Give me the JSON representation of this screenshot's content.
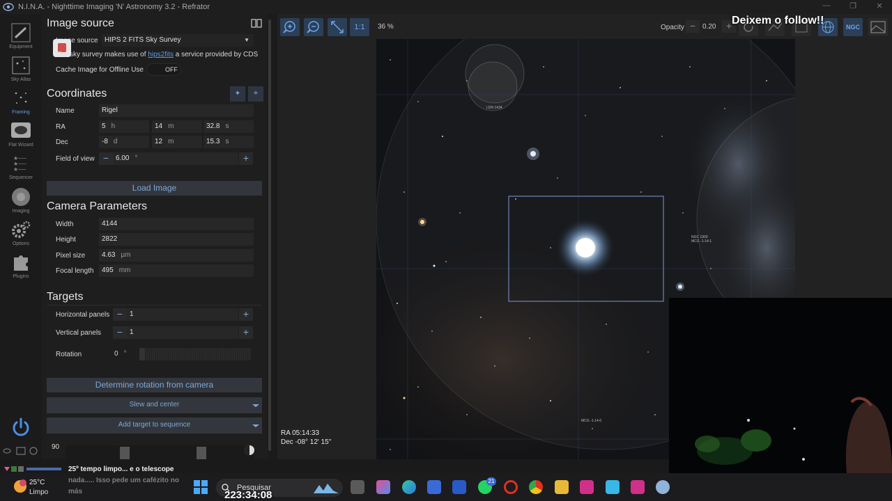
{
  "window": {
    "title": "N.I.N.A. - Nighttime Imaging 'N' Astronomy 3.2   -  Refrator"
  },
  "nav": {
    "items": [
      {
        "label": "Equipment"
      },
      {
        "label": "Sky Atlas"
      },
      {
        "label": "Framing",
        "active": true
      },
      {
        "label": "Flat Wizard"
      },
      {
        "label": "Sequencer"
      },
      {
        "label": "Imaging"
      },
      {
        "label": "Options"
      },
      {
        "label": "Plugins"
      }
    ]
  },
  "image_source": {
    "heading": "Image source",
    "source_label": "Image source",
    "source_value": "HIPS 2 FITS Sky Survey",
    "note_prefix": "The sky survey makes use of",
    "note_link": "hips2fits",
    "note_suffix": "a service provided by CDS",
    "cache_label": "Cache Image for Offline Use",
    "cache_toggle": "OFF"
  },
  "coordinates": {
    "heading": "Coordinates",
    "name_label": "Name",
    "name_value": "Rigel",
    "ra_label": "RA",
    "ra": {
      "h": "5",
      "h_unit": "h",
      "m": "14",
      "m_unit": "m",
      "s": "32.8",
      "s_unit": "s"
    },
    "dec_label": "Dec",
    "dec": {
      "d": "-8",
      "d_unit": "d",
      "m": "12",
      "m_unit": "m",
      "s": "15.3",
      "s_unit": "s"
    },
    "fov_label": "Field of view",
    "fov_value": "6.00",
    "fov_unit": "°",
    "load_button": "Load Image"
  },
  "camera": {
    "heading": "Camera Parameters",
    "width_label": "Width",
    "width_value": "4144",
    "height_label": "Height",
    "height_value": "2822",
    "pixel_label": "Pixel size",
    "pixel_value": "4.63",
    "pixel_unit": "µm",
    "focal_label": "Focal length",
    "focal_value": "495",
    "focal_unit": "mm"
  },
  "targets": {
    "heading": "Targets",
    "hpanels_label": "Horizontal panels",
    "hpanels_value": "1",
    "vpanels_label": "Vertical panels",
    "vpanels_value": "1",
    "rotation_label": "Rotation",
    "rotation_value": "0",
    "rotation_unit": "°"
  },
  "actions": {
    "determine": "Determine rotation from camera",
    "slew": "Slew and center",
    "add_target": "Add target to sequence"
  },
  "bottom_panel": {
    "value": "90"
  },
  "viewer": {
    "zoom_fit": "1:1",
    "zoom_percent": "36 %",
    "opacity_label": "Opacity",
    "opacity_value": "0.20",
    "ngc_label": "NGC",
    "ra_readout": "RA  05:14:33",
    "dec_readout": "Dec  -08° 12' 15\"",
    "sky_labels": {
      "ldn": "LDN 1434",
      "ngc1": "NGC 1909",
      "ngc2": "MCG -1-14-1",
      "mcg": "MCG -1-14-0"
    }
  },
  "overlay": {
    "follow": "Deixem o follow!!"
  },
  "chat": {
    "message": "25º tempo limpo... e o telescope nada..... Isso pede um cafézito no más"
  },
  "taskbar": {
    "temperature": "25°C",
    "condition": "Limpo",
    "search_placeholder": "Pesquisar",
    "clock": "223:34:08",
    "whatsapp_badge": "21"
  }
}
